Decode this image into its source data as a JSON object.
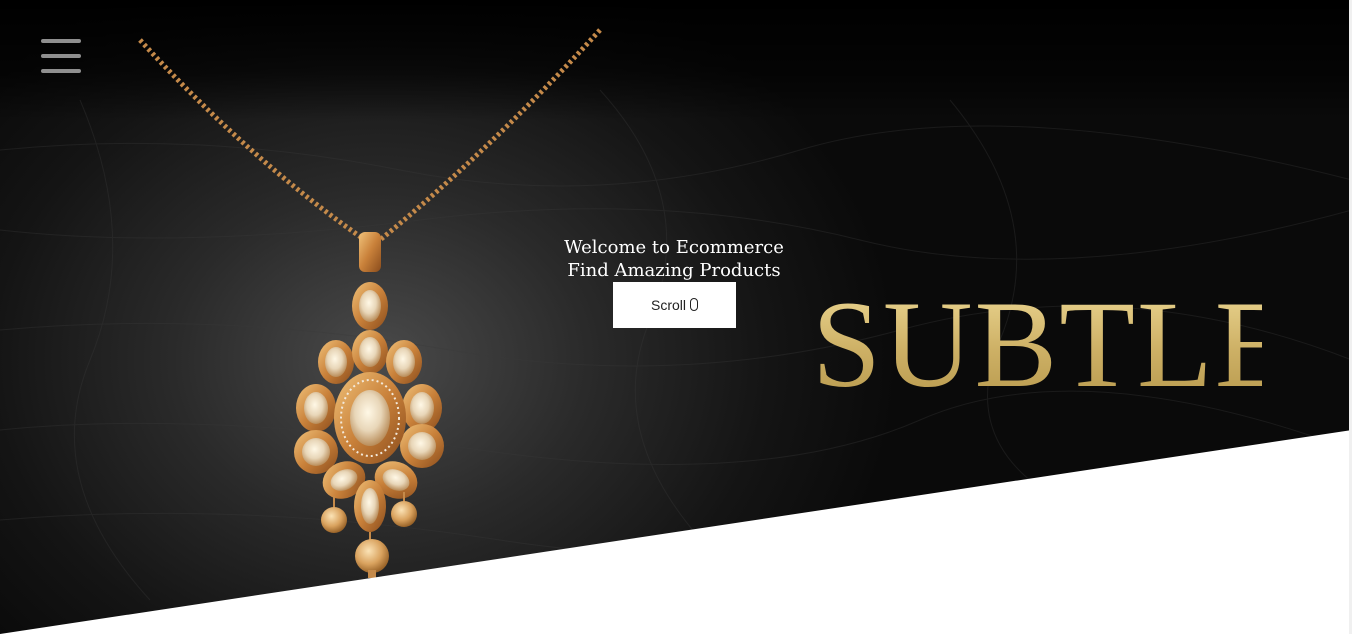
{
  "nav": {
    "menu_icon": "hamburger-menu-icon"
  },
  "hero": {
    "welcome_line1": "Welcome to Ecommerce",
    "welcome_line2": "Find Amazing Products",
    "scroll_label": "Scroll",
    "scroll_icon": "mouse-icon",
    "brand_word": "SUBTLE",
    "colors": {
      "background": "#0a0a0a",
      "brand_gold": "#d8c07a",
      "button_bg": "#ffffff",
      "menu_icon": "#8f8f8f"
    }
  }
}
